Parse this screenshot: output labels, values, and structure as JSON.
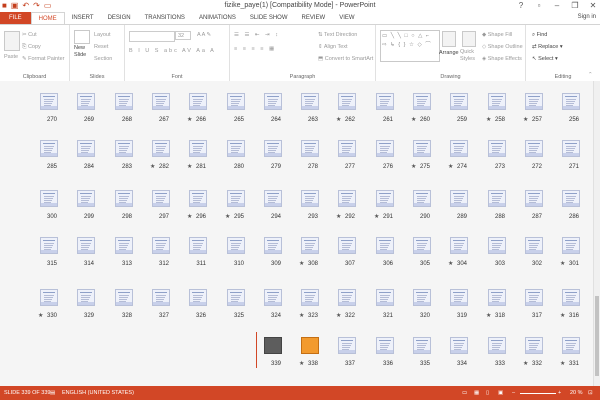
{
  "window": {
    "title": "fizike_paye(1) [Compatibility Mode] - PowerPoint",
    "signin": "Sign in"
  },
  "tabs": [
    "FILE",
    "HOME",
    "INSERT",
    "DESIGN",
    "TRANSITIONS",
    "ANIMATIONS",
    "SLIDE SHOW",
    "REVIEW",
    "VIEW"
  ],
  "ribbon": {
    "clipboard": {
      "label": "Clipboard",
      "paste": "Paste",
      "cut": "Cut",
      "copy": "Copy",
      "format_painter": "Format Painter"
    },
    "slides": {
      "label": "Slides",
      "new_slide": "New\nSlide",
      "layout": "Layout",
      "reset": "Reset",
      "section": "Section"
    },
    "font": {
      "label": "Font",
      "size": "32"
    },
    "paragraph": {
      "label": "Paragraph",
      "text_direction": "Text Direction",
      "align_text": "Align Text",
      "convert": "Convert to SmartArt"
    },
    "drawing": {
      "label": "Drawing",
      "arrange": "Arrange",
      "quick_styles": "Quick Styles",
      "shape_fill": "Shape Fill",
      "shape_outline": "Shape Outline",
      "shape_effects": "Shape Effects"
    },
    "editing": {
      "label": "Editing",
      "find": "Find",
      "replace": "Replace",
      "select": "Select"
    }
  },
  "rows": [
    [
      "270",
      "269",
      "268",
      "267",
      "266",
      "265",
      "264",
      "263",
      "262",
      "261",
      "260",
      "259",
      "258",
      "257",
      "256"
    ],
    [
      "285",
      "284",
      "283",
      "282",
      "281",
      "280",
      "279",
      "278",
      "277",
      "276",
      "275",
      "274",
      "273",
      "272",
      "271"
    ],
    [
      "300",
      "299",
      "298",
      "297",
      "296",
      "295",
      "294",
      "293",
      "292",
      "291",
      "290",
      "289",
      "288",
      "287",
      "286"
    ],
    [
      "315",
      "314",
      "313",
      "312",
      "311",
      "310",
      "309",
      "308",
      "307",
      "306",
      "305",
      "304",
      "303",
      "302",
      "301"
    ],
    [
      "330",
      "329",
      "328",
      "327",
      "326",
      "325",
      "324",
      "323",
      "322",
      "321",
      "320",
      "319",
      "318",
      "317",
      "316"
    ],
    [
      "339",
      "338",
      "337",
      "336",
      "335",
      "334",
      "333",
      "332",
      "331"
    ]
  ],
  "starred": [
    "266",
    "262",
    "260",
    "258",
    "257",
    "282",
    "281",
    "275",
    "274",
    "296",
    "295",
    "292",
    "291",
    "308",
    "304",
    "301",
    "330",
    "323",
    "322",
    "318",
    "316",
    "338",
    "332",
    "331"
  ],
  "status": {
    "slide": "SLIDE 339 OF 339",
    "language": "ENGLISH (UNITED STATES)",
    "zoom": "20 %"
  }
}
